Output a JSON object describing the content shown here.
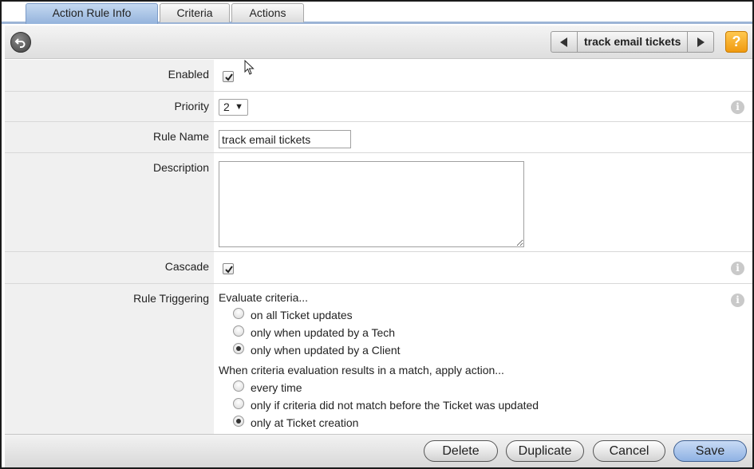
{
  "tabs": [
    {
      "label": "Action Rule Info",
      "active": true
    },
    {
      "label": "Criteria",
      "active": false
    },
    {
      "label": "Actions",
      "active": false
    }
  ],
  "toolbar": {
    "record_title": "track email tickets",
    "help_label": "?"
  },
  "fields": {
    "enabled": {
      "label": "Enabled",
      "checked": true
    },
    "priority": {
      "label": "Priority",
      "value": "2"
    },
    "rule_name": {
      "label": "Rule Name",
      "value": "track email tickets"
    },
    "description": {
      "label": "Description",
      "value": ""
    },
    "cascade": {
      "label": "Cascade",
      "checked": true
    },
    "rule_triggering": {
      "label": "Rule Triggering",
      "evaluate_heading": "Evaluate criteria...",
      "evaluate_options": [
        {
          "label": "on all Ticket updates",
          "selected": false
        },
        {
          "label": "only when updated by a Tech",
          "selected": false
        },
        {
          "label": "only when updated by a Client",
          "selected": true
        }
      ],
      "apply_heading": "When criteria evaluation results in a match, apply action...",
      "apply_options": [
        {
          "label": "every time",
          "selected": false
        },
        {
          "label": "only if criteria did not match before the Ticket was updated",
          "selected": false
        },
        {
          "label": "only at Ticket creation",
          "selected": true
        }
      ]
    }
  },
  "info_icon_glyph": "i",
  "footer": {
    "delete_label": "Delete",
    "duplicate_label": "Duplicate",
    "cancel_label": "Cancel",
    "save_label": "Save"
  },
  "colors": {
    "active_tab": "#94b3dc",
    "help_button": "#f09a10",
    "label_column_bg": "#f0f0f0"
  }
}
